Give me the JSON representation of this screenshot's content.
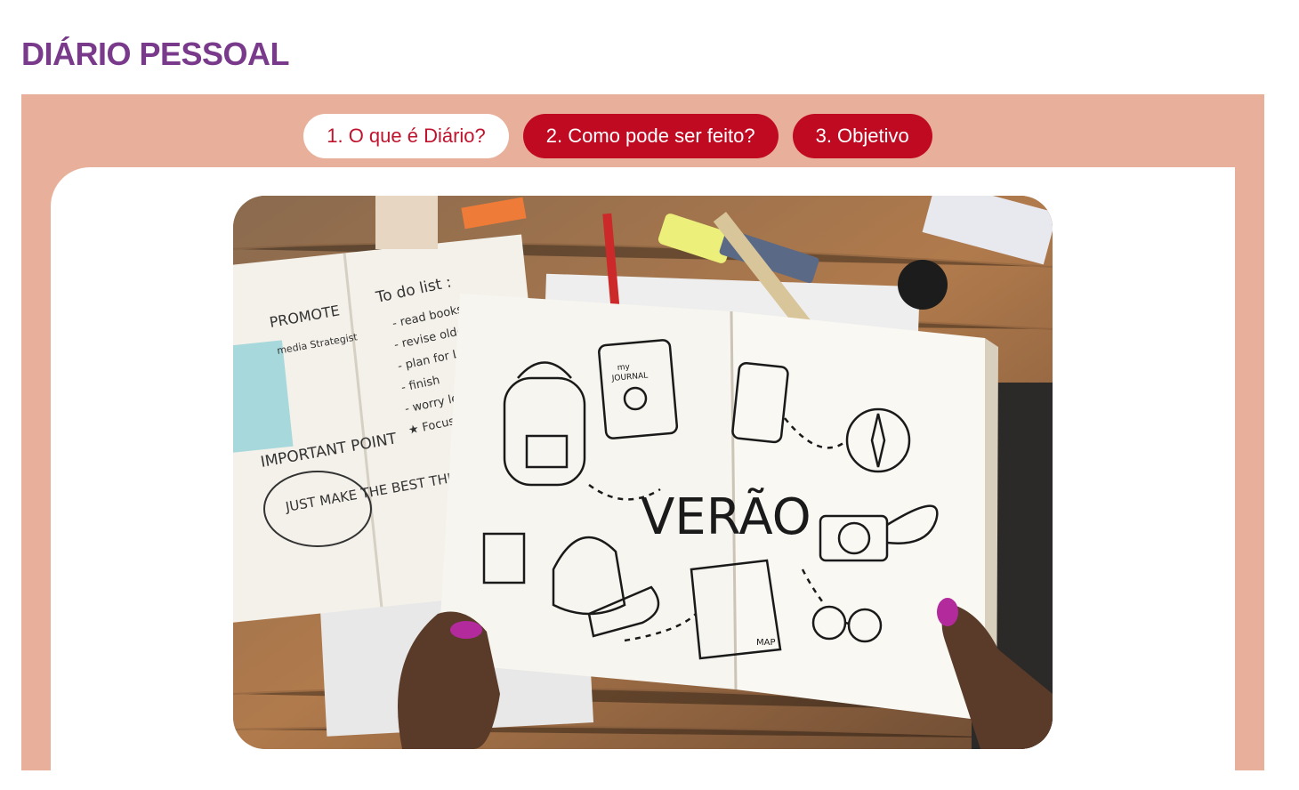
{
  "page": {
    "title": "DIÁRIO PESSOAL"
  },
  "tabs": [
    {
      "label": "1. O que é Diário?",
      "active": true
    },
    {
      "label": "2. Como pode ser feito?",
      "active": false
    },
    {
      "label": "3. Objetivo",
      "active": false
    }
  ],
  "colors": {
    "title": "#7a3a8c",
    "panel": "#e8b09a",
    "tab_active_bg": "#ffffff",
    "tab_active_text": "#c0132d",
    "tab_inactive_bg": "#c00a22"
  },
  "photo": {
    "notebook_left": {
      "lines": [
        "PROMOTE",
        "media Strategist",
        "IMPORTANT POINT",
        "JUST MAKE THE BEST THINGS!"
      ],
      "todo_title": "To do list :",
      "todo_items": [
        "- read books",
        "- revise older",
        "- plan for L",
        "- finish",
        "- worry less",
        "★ Focus"
      ]
    },
    "journal_title": "VERÃO",
    "journal_cover_text": [
      "my",
      "JOURNAL"
    ],
    "map_label": "MAP"
  }
}
